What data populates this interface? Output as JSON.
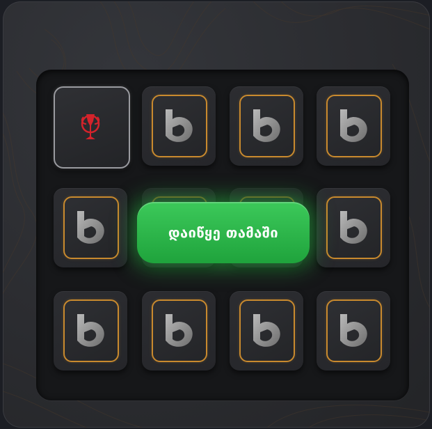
{
  "game": {
    "start_button_label": "დაიწყე თამაში",
    "accent_color": "#c98a2e",
    "button_color": "#22b043",
    "grid": {
      "rows": 3,
      "columns": 4,
      "tiles": [
        {
          "state": "revealed",
          "icon": "trophy-icon"
        },
        {
          "state": "hidden",
          "icon": "b-logo-icon"
        },
        {
          "state": "hidden",
          "icon": "b-logo-icon"
        },
        {
          "state": "hidden",
          "icon": "b-logo-icon"
        },
        {
          "state": "hidden",
          "icon": "b-logo-icon"
        },
        {
          "state": "hidden",
          "icon": "b-logo-icon"
        },
        {
          "state": "hidden",
          "icon": "b-logo-icon"
        },
        {
          "state": "hidden",
          "icon": "b-logo-icon"
        },
        {
          "state": "hidden",
          "icon": "b-logo-icon"
        },
        {
          "state": "hidden",
          "icon": "b-logo-icon"
        },
        {
          "state": "hidden",
          "icon": "b-logo-icon"
        },
        {
          "state": "hidden",
          "icon": "b-logo-icon"
        }
      ]
    }
  }
}
